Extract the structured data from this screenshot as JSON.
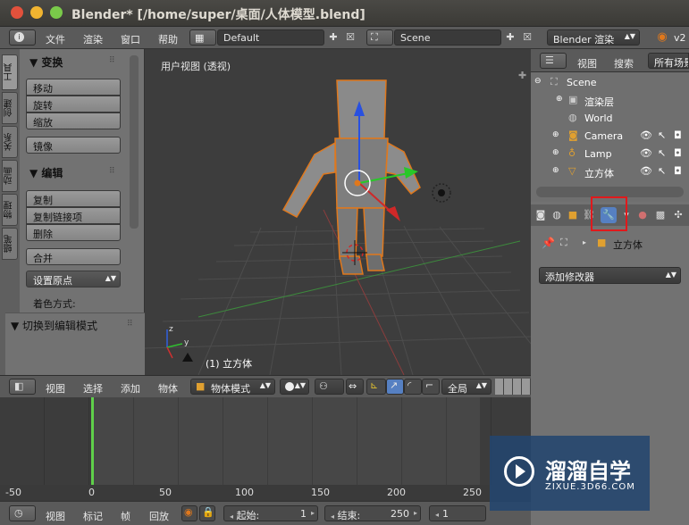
{
  "window": {
    "title": "Blender* [/home/super/桌面/人体模型.blend]"
  },
  "topbar": {
    "menus": [
      "文件",
      "渲染",
      "窗口",
      "帮助"
    ],
    "layout": "Default",
    "scene": "Scene",
    "engine": "Blender 渲染",
    "version": "v2"
  },
  "toolshelf": {
    "tabs": [
      "工具",
      "创建",
      "关系",
      "动画",
      "物理",
      "蜡笔"
    ],
    "transform_header": "▼ 变换",
    "transform_buttons": [
      "移动",
      "旋转",
      "缩放"
    ],
    "mirror": "镜像",
    "edit_header": "▼ 编辑",
    "edit_buttons": [
      "复制",
      "复制链接项",
      "删除"
    ],
    "join": "合并",
    "origin": "设置原点",
    "shading_label": "着色方式:",
    "mode_toggle": "▼ 切换到编辑模式"
  },
  "viewport": {
    "view_label": "用户视图 (透视)",
    "object_label": "(1) 立方体"
  },
  "viewport_header": {
    "menus": [
      "视图",
      "选择",
      "添加",
      "物体"
    ],
    "mode": "物体模式",
    "orientation": "全局"
  },
  "timeline": {
    "ruler": [
      "-50",
      "0",
      "50",
      "100",
      "150",
      "200",
      "250"
    ],
    "menus": [
      "视图",
      "标记",
      "帧",
      "回放"
    ],
    "start_label": "起始:",
    "start_value": "1",
    "end_label": "结束:",
    "end_value": "250",
    "current": "1"
  },
  "outliner": {
    "menus": [
      "视图",
      "搜索",
      "所有场景"
    ],
    "items": [
      {
        "label": "Scene"
      },
      {
        "label": "渲染层"
      },
      {
        "label": "World"
      },
      {
        "label": "Camera"
      },
      {
        "label": "Lamp"
      },
      {
        "label": "立方体"
      }
    ]
  },
  "properties": {
    "object_name": "立方体",
    "add_modifier": "添加修改器"
  },
  "watermark": {
    "title": "溜溜自学",
    "url": "ZIXUE.3D66.COM"
  },
  "colors": {
    "accent": "#e0781c",
    "highlight_box": "#e0191c",
    "active_tab": "#5680c2"
  }
}
